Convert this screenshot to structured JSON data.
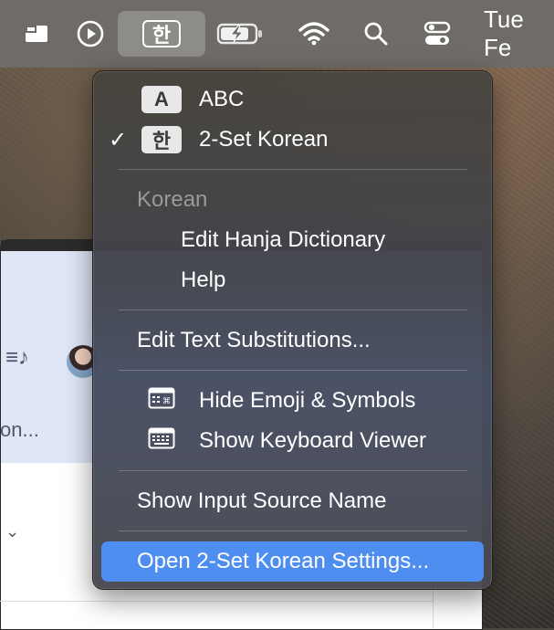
{
  "menubar": {
    "icons": [
      "screen-mirroring-icon",
      "play-circle-icon",
      "input-source-icon",
      "battery-charging-icon",
      "wifi-icon",
      "search-icon",
      "control-center-icon"
    ],
    "input_source_glyph": "한",
    "clock": "Tue Fe"
  },
  "background_window": {
    "truncated_text": "on...",
    "chevron": "⌄"
  },
  "menu": {
    "items": [
      {
        "label": "ABC",
        "badge": "A",
        "checked": false
      },
      {
        "label": "2-Set Korean",
        "badge": "한",
        "checked": true,
        "check_glyph": "✓"
      }
    ],
    "section_header": "Korean",
    "korean_items": [
      "Edit Hanja Dictionary",
      "Help"
    ],
    "edit_text_substitutions": "Edit Text Substitutions...",
    "hide_emoji": "Hide Emoji & Symbols",
    "show_keyboard_viewer": "Show Keyboard Viewer",
    "show_input_source_name": "Show Input Source Name",
    "open_settings": "Open 2-Set Korean Settings..."
  },
  "colors": {
    "menubar": "#6f6c68",
    "highlight": "#4d8ef0",
    "menu_text": "#ffffff"
  }
}
